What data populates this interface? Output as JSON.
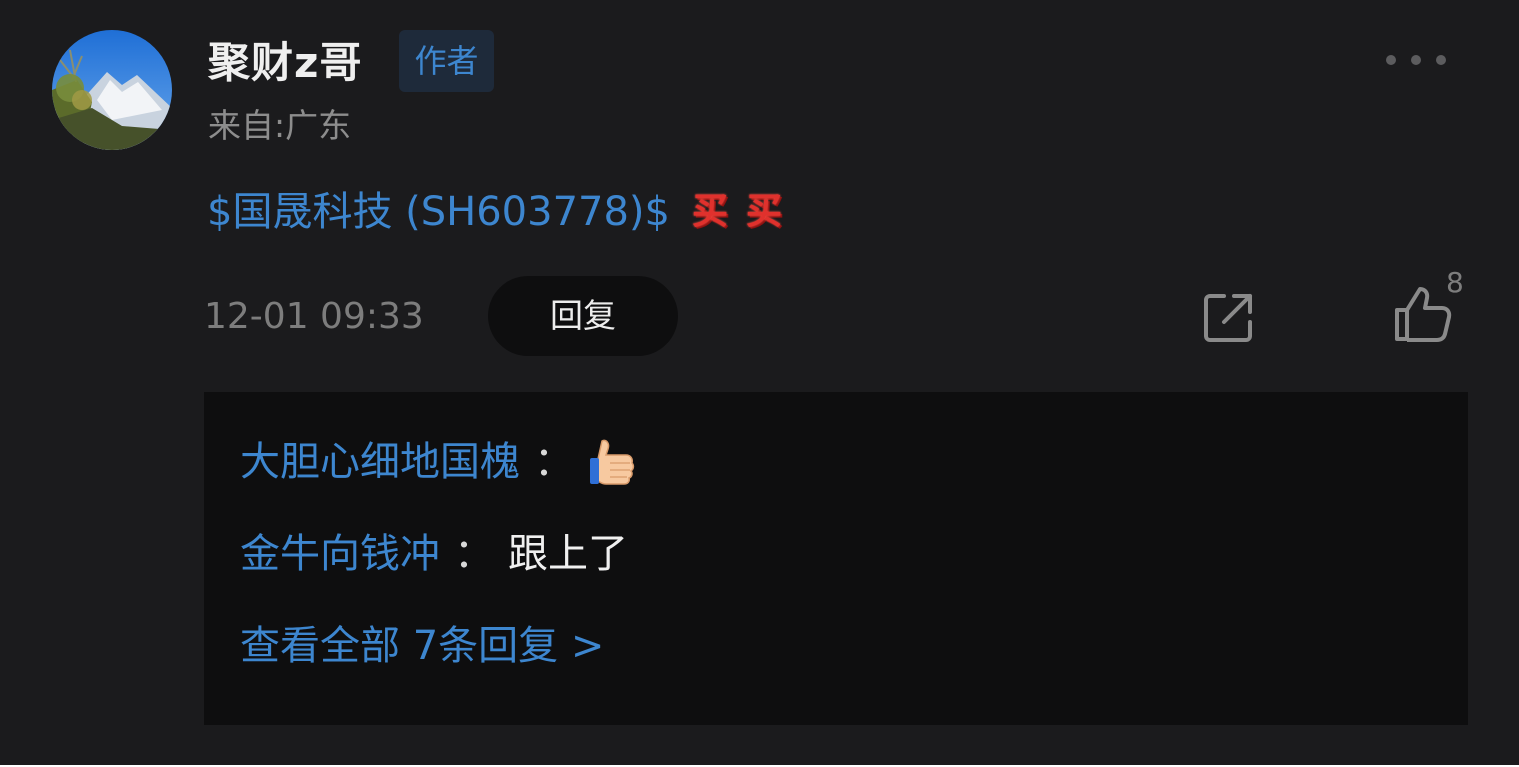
{
  "post": {
    "username": "聚财z哥",
    "author_badge": "作者",
    "location": "来自:广东",
    "stock_link": "$国晟科技 (SH603778)$",
    "buy_emojis": [
      "买",
      "买"
    ],
    "timestamp": "12-01 09:33",
    "reply_label": "回复",
    "like_count": "8"
  },
  "replies": [
    {
      "author": "大胆心细地国槐",
      "colon": "：",
      "text": "",
      "emoji": "thumbs-up-icon"
    },
    {
      "author": "金牛向钱冲",
      "colon": "：",
      "text": "跟上了"
    }
  ],
  "view_all_label": "查看全部 7条回复 >",
  "colors": {
    "background": "#1b1b1d",
    "link": "#3d86cf",
    "muted": "#7d7d7d",
    "reply_box": "#0e0e0f",
    "buy_red": "#e0312d"
  }
}
